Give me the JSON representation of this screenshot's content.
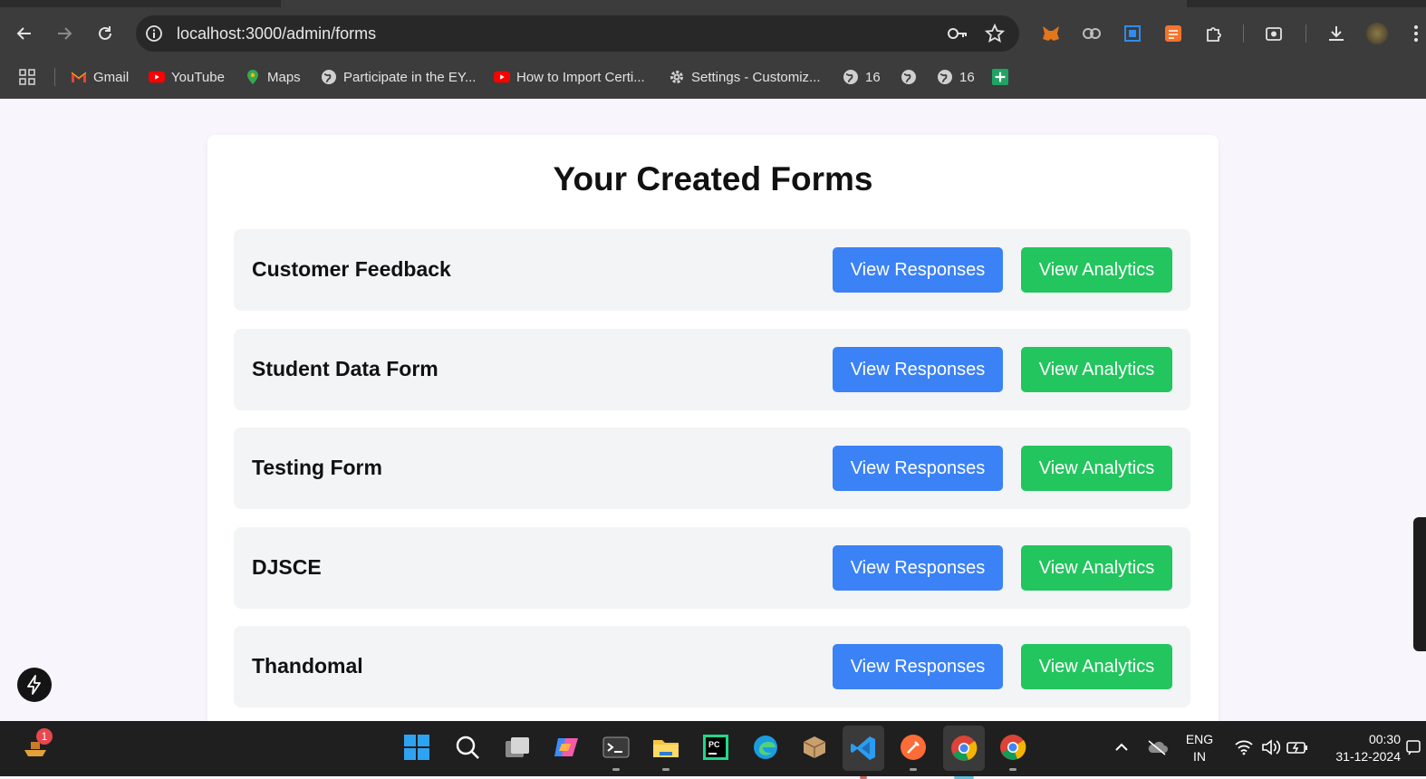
{
  "browser": {
    "url": "localhost:3000/admin/forms",
    "bookmarks": [
      {
        "label": "Gmail",
        "icon": "gmail-icon"
      },
      {
        "label": "YouTube",
        "icon": "youtube-icon"
      },
      {
        "label": "Maps",
        "icon": "maps-icon"
      },
      {
        "label": "Participate in the EY...",
        "icon": "globe-icon"
      },
      {
        "label": "How to Import Certi...",
        "icon": "youtube-icon"
      },
      {
        "label": "Settings - Customiz...",
        "icon": "gear-icon"
      },
      {
        "label": "16",
        "icon": "globe-icon"
      },
      {
        "label": "",
        "icon": "globe-icon"
      },
      {
        "label": "16",
        "icon": "globe-icon"
      },
      {
        "label": "",
        "icon": "sheets-icon"
      }
    ]
  },
  "page": {
    "title": "Your Created Forms",
    "forms": [
      {
        "name": "Customer Feedback",
        "responses_label": "View Responses",
        "analytics_label": "View Analytics"
      },
      {
        "name": "Student Data Form",
        "responses_label": "View Responses",
        "analytics_label": "View Analytics"
      },
      {
        "name": "Testing Form",
        "responses_label": "View Responses",
        "analytics_label": "View Analytics"
      },
      {
        "name": "DJSCE",
        "responses_label": "View Responses",
        "analytics_label": "View Analytics"
      },
      {
        "name": "Thandomal",
        "responses_label": "View Responses",
        "analytics_label": "View Analytics"
      }
    ]
  },
  "taskbar": {
    "notification_badge": "1",
    "language": "ENG",
    "region": "IN",
    "time": "00:30",
    "date": "31-12-2024"
  },
  "colors": {
    "primary_blue": "#3b82f6",
    "success_green": "#22c55e",
    "row_bg": "#f3f4f6",
    "page_bg": "#f8f6fc"
  }
}
